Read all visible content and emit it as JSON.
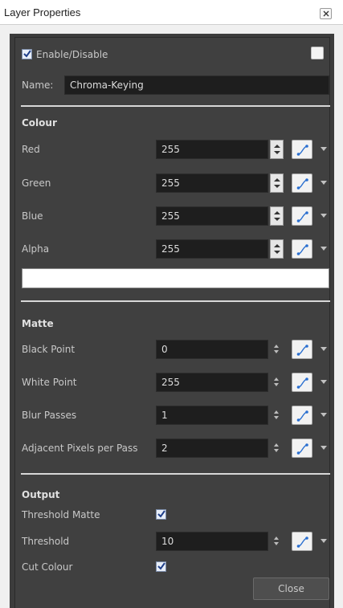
{
  "window": {
    "title": "Layer Properties"
  },
  "enable": {
    "label": "Enable/Disable",
    "checked": true
  },
  "name": {
    "label": "Name:",
    "value": "Chroma-Keying"
  },
  "colour": {
    "header": "Colour",
    "rows": [
      {
        "label": "Red",
        "value": "255"
      },
      {
        "label": "Green",
        "value": "255"
      },
      {
        "label": "Blue",
        "value": "255"
      },
      {
        "label": "Alpha",
        "value": "255"
      }
    ],
    "swatch_color": "#ffffff"
  },
  "matte": {
    "header": "Matte",
    "rows": [
      {
        "label": "Black Point",
        "value": "0"
      },
      {
        "label": "White Point",
        "value": "255"
      },
      {
        "label": "Blur Passes",
        "value": "1"
      },
      {
        "label": "Adjacent Pixels per Pass",
        "value": "2"
      }
    ]
  },
  "output": {
    "header": "Output",
    "threshold_matte": {
      "label": "Threshold Matte",
      "checked": true
    },
    "threshold": {
      "label": "Threshold",
      "value": "10"
    },
    "cut_colour": {
      "label": "Cut Colour",
      "checked": true
    }
  },
  "buttons": {
    "close_label": "Close"
  },
  "icons": {
    "window_close": "close-x-icon",
    "spin": "up-down-arrows-icon",
    "function": "function-curve-icon",
    "dropdown": "dropdown-arrow-icon"
  },
  "colors": {
    "panel_bg": "#3c3c3c",
    "field_bg": "#1e1e1e",
    "text": "#c8c8c8",
    "function_accent": "#2a6fd0"
  }
}
